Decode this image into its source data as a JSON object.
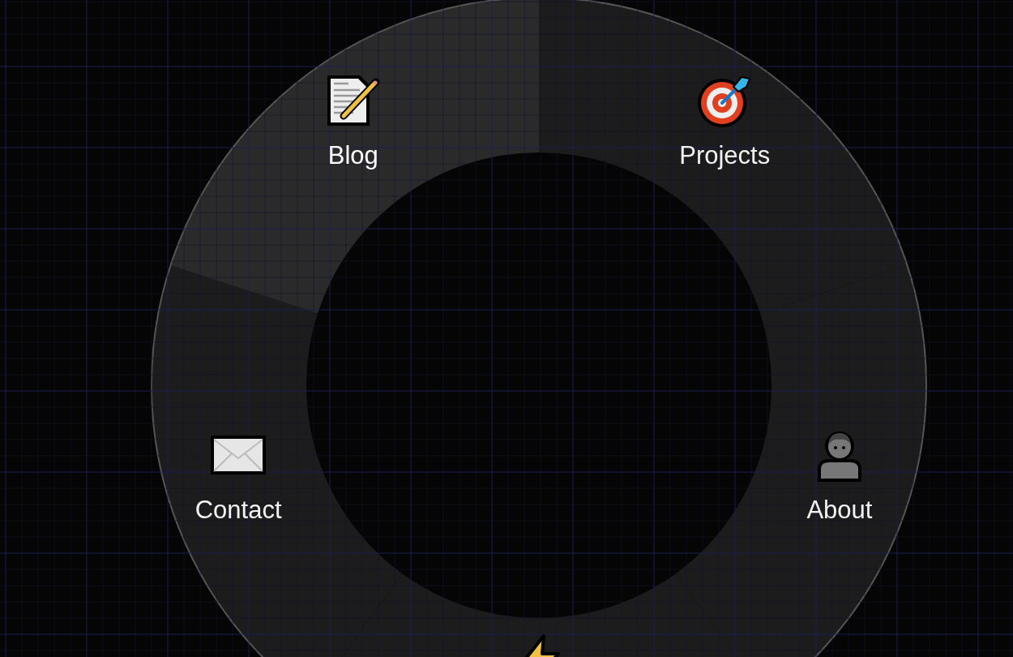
{
  "radial_menu": {
    "items": [
      {
        "label": "Projects",
        "kind": "target",
        "selected": false
      },
      {
        "label": "About",
        "kind": "person",
        "selected": false
      },
      {
        "kind": "bolt",
        "selected": false
      },
      {
        "label": "Contact",
        "kind": "envelope",
        "selected": false
      },
      {
        "label": "Blog",
        "kind": "memo",
        "selected": true
      }
    ]
  }
}
